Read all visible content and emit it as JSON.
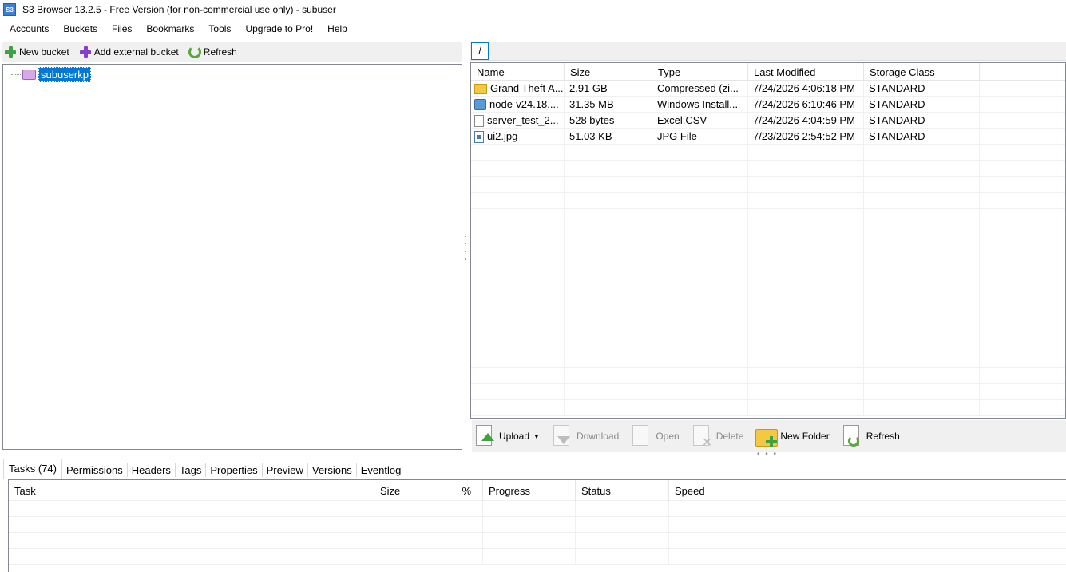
{
  "window": {
    "app_icon_text": "S3",
    "title": "S3 Browser 13.2.5 - Free Version (for non-commercial use only) - subuser"
  },
  "menu": {
    "items": [
      "Accounts",
      "Buckets",
      "Files",
      "Bookmarks",
      "Tools",
      "Upgrade to Pro!",
      "Help"
    ]
  },
  "left_toolbar": {
    "new_bucket": "New bucket",
    "add_external_bucket": "Add external bucket",
    "refresh": "Refresh"
  },
  "tree": {
    "selected_bucket": "subuserkp"
  },
  "path": {
    "current": "/"
  },
  "file_list": {
    "columns": [
      "Name",
      "Size",
      "Type",
      "Last Modified",
      "Storage Class"
    ],
    "sort_column": "Name",
    "rows": [
      {
        "icon": "zip-folder-icon",
        "name": "Grand Theft A...",
        "size": "2.91 GB",
        "type": "Compressed (zi...",
        "modified": "7/24/2026 4:06:18 PM",
        "storage_class": "STANDARD"
      },
      {
        "icon": "installer-icon",
        "name": "node-v24.18....",
        "size": "31.35 MB",
        "type": "Windows Install...",
        "modified": "7/24/2026 6:10:46 PM",
        "storage_class": "STANDARD"
      },
      {
        "icon": "document-icon",
        "name": "server_test_2...",
        "size": "528 bytes",
        "type": "Excel.CSV",
        "modified": "7/24/2026 4:04:59 PM",
        "storage_class": "STANDARD"
      },
      {
        "icon": "image-file-icon",
        "name": "ui2.jpg",
        "size": "51.03 KB",
        "type": "JPG File",
        "modified": "7/23/2026 2:54:52 PM",
        "storage_class": "STANDARD"
      }
    ]
  },
  "file_toolbar": {
    "upload": "Upload",
    "download": "Download",
    "open": "Open",
    "delete": "Delete",
    "new_folder": "New Folder",
    "refresh": "Refresh"
  },
  "bottom_tabs": {
    "items": [
      "Tasks (74)",
      "Permissions",
      "Headers",
      "Tags",
      "Properties",
      "Preview",
      "Versions",
      "Eventlog"
    ],
    "active": "Tasks (74)"
  },
  "tasks": {
    "columns": [
      "Task",
      "Size",
      "%",
      "Progress",
      "Status",
      "Speed"
    ]
  },
  "colors": {
    "selection": "#0078d7",
    "border": "#828790"
  }
}
